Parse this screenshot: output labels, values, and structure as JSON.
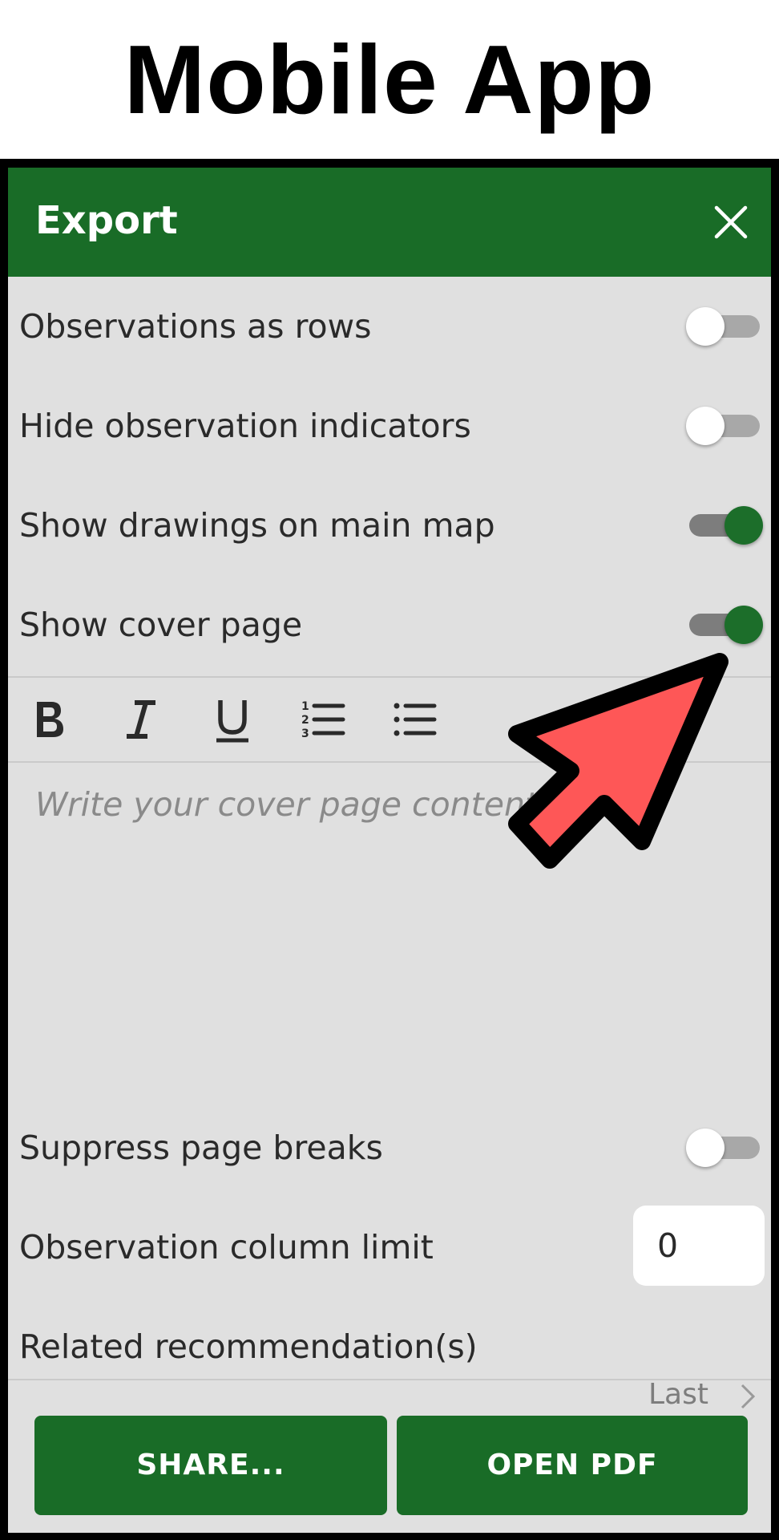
{
  "caption": "Mobile App",
  "header": {
    "title": "Export",
    "close_icon": "close-icon"
  },
  "options": [
    {
      "label": "Observations as rows",
      "on": false
    },
    {
      "label": "Hide observation indicators",
      "on": false
    },
    {
      "label": "Show drawings on main map",
      "on": true
    },
    {
      "label": "Show cover page",
      "on": true
    }
  ],
  "toolbar": {
    "icons": [
      "bold-icon",
      "italic-icon",
      "underline-icon",
      "numbered-list-icon",
      "bulleted-list-icon"
    ]
  },
  "editor": {
    "placeholder": "Write your cover page content"
  },
  "suppress": {
    "label": "Suppress page breaks",
    "on": false
  },
  "column_limit": {
    "label": "Observation column limit",
    "value": "0"
  },
  "related": {
    "label": "Related recommendation(s)",
    "value": "Last"
  },
  "buttons": {
    "share": "SHARE...",
    "open_pdf": "OPEN PDF"
  },
  "colors": {
    "brand": "#196c27",
    "panel": "#e0e0e0",
    "arrow": "#fe5757"
  }
}
